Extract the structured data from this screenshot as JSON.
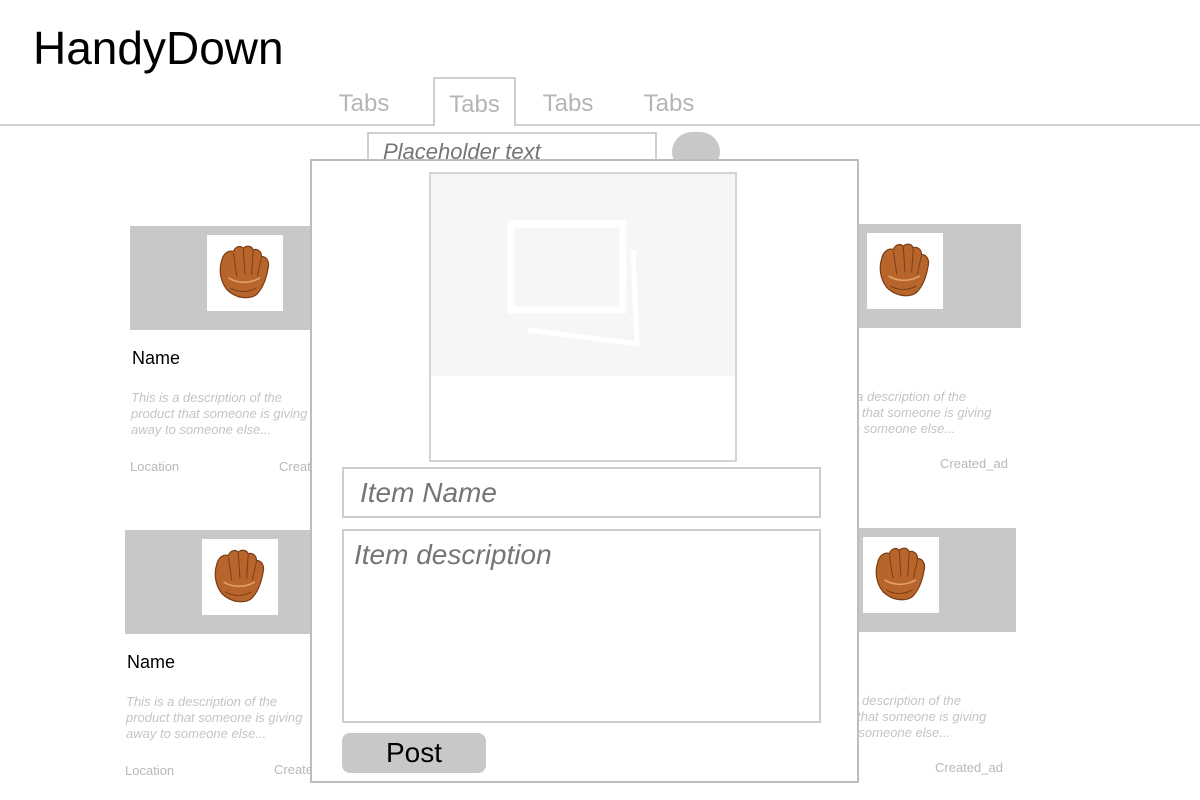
{
  "app": {
    "title": "HandyDown"
  },
  "tabs": [
    {
      "label": "Tabs",
      "active": false
    },
    {
      "label": "Tabs",
      "active": true
    },
    {
      "label": "Tabs",
      "active": false
    },
    {
      "label": "Tabs",
      "active": false
    }
  ],
  "search": {
    "placeholder": "Placeholder text"
  },
  "cards": [
    {
      "name": "Name",
      "description": "This is a description of the product that someone is giving away to someone else...",
      "location": "Location",
      "created": "Created_ad"
    },
    {
      "name": "",
      "description": "This is a description of the product that someone is giving away to someone else...",
      "location": "",
      "created": "Created_ad"
    },
    {
      "name": "Name",
      "description": "This is a description of the product that someone is giving away to someone else...",
      "location": "Location",
      "created": "Created_ad"
    },
    {
      "name": "",
      "description": "This is a description of the product that someone is giving away to someone else...",
      "location": "",
      "created": "Created_ad"
    }
  ],
  "icons": {
    "card_image": "baseball-glove-icon",
    "upload_image": "image-placeholder-icon"
  },
  "modal": {
    "item_name_placeholder": "Item Name",
    "item_description_placeholder": "Item description",
    "post_label": "Post"
  },
  "colors": {
    "band": "#c8c8c8",
    "muted_text": "#b5b5b5"
  }
}
